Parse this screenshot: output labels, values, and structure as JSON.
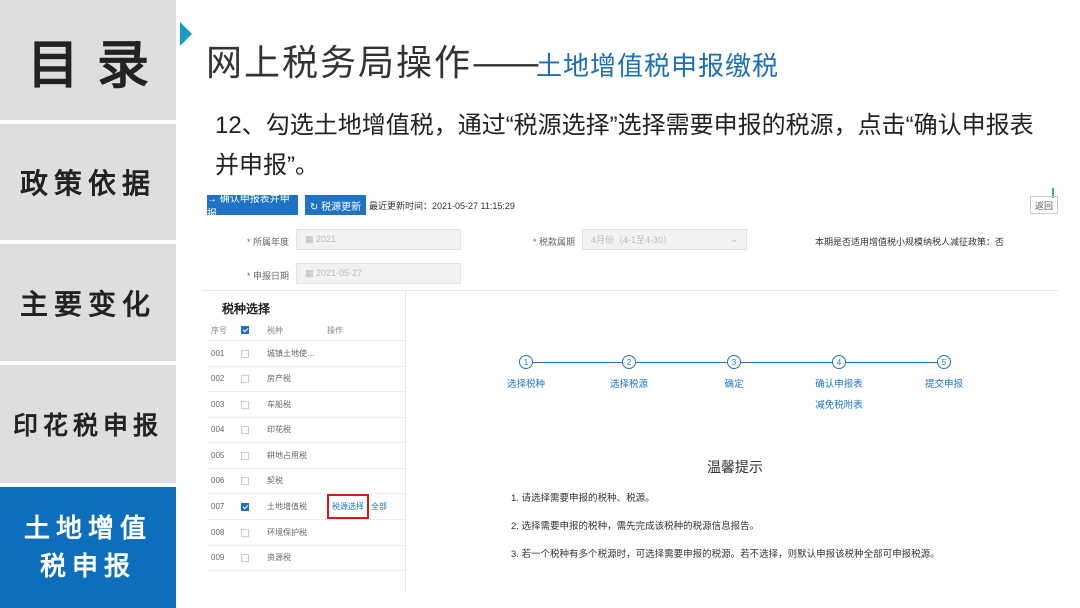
{
  "nav": {
    "items": [
      {
        "label": "目录"
      },
      {
        "label": "政策依据"
      },
      {
        "label": "主要变化"
      },
      {
        "label": "印花税申报"
      },
      {
        "label": "土地增值税申报"
      }
    ],
    "active_index": 4
  },
  "header": {
    "title_main": "网上税务局操作",
    "title_dash": "——",
    "title_sub": "土地增值税申报缴税"
  },
  "instruction": "12、勾选土地增值税，通过“税源选择”选择需要申报的税源，点击“确认申报表并申报”。",
  "toolbar": {
    "confirm_button": "→ 确认申报表并申报",
    "refresh_button": "↻ 税源更新",
    "update_time": "最近更新时间：2021-05-27 11:15:29",
    "back_button": "返回"
  },
  "form": {
    "year_label": "* 所属年度",
    "year_value": "▦ 2021",
    "period_label": "* 税款属期",
    "period_value": "4月份（4-1至4-30）",
    "date_label": "* 申报日期",
    "date_value": "▦ 2021-05-27",
    "right_note": "本期是否适用增值税小规模纳税人减征政策：否"
  },
  "tax_table": {
    "title": "税种选择",
    "headers": [
      "序号",
      "",
      "税种",
      "操作"
    ],
    "rows": [
      {
        "no": "001",
        "name": "城镇土地使…",
        "checked": false
      },
      {
        "no": "002",
        "name": "房产税",
        "checked": false
      },
      {
        "no": "003",
        "name": "车船税",
        "checked": false
      },
      {
        "no": "004",
        "name": "印花税",
        "checked": false
      },
      {
        "no": "005",
        "name": "耕地占用税",
        "checked": false
      },
      {
        "no": "006",
        "name": "契税",
        "checked": false
      },
      {
        "no": "007",
        "name": "土地增值税",
        "checked": true,
        "op_select": "税源选择",
        "op_all": "全部"
      },
      {
        "no": "008",
        "name": "环境保护税",
        "checked": false
      },
      {
        "no": "009",
        "name": "资源税",
        "checked": false
      }
    ]
  },
  "steps": [
    {
      "num": "1",
      "label": "选择税种"
    },
    {
      "num": "2",
      "label": "选择税源"
    },
    {
      "num": "3",
      "label": "确定"
    },
    {
      "num": "4",
      "label": "确认申报表",
      "label2": "减免税附表"
    },
    {
      "num": "5",
      "label": "提交申报"
    }
  ],
  "tips": {
    "title": "温馨提示",
    "items": [
      "1. 请选择需要申报的税种、税源。",
      "2. 选择需要申报的税种，需先完成该税种的税源信息报告。",
      "3. 若一个税种有多个税源时，可选择需要申报的税源。若不选择，则默认申报该税种全部可申报税源。"
    ]
  },
  "colors": {
    "nav_active": "#0d6ebd",
    "nav_inactive": "#dedede",
    "primary": "#1e73c7",
    "highlight_box": "#d9151c"
  }
}
